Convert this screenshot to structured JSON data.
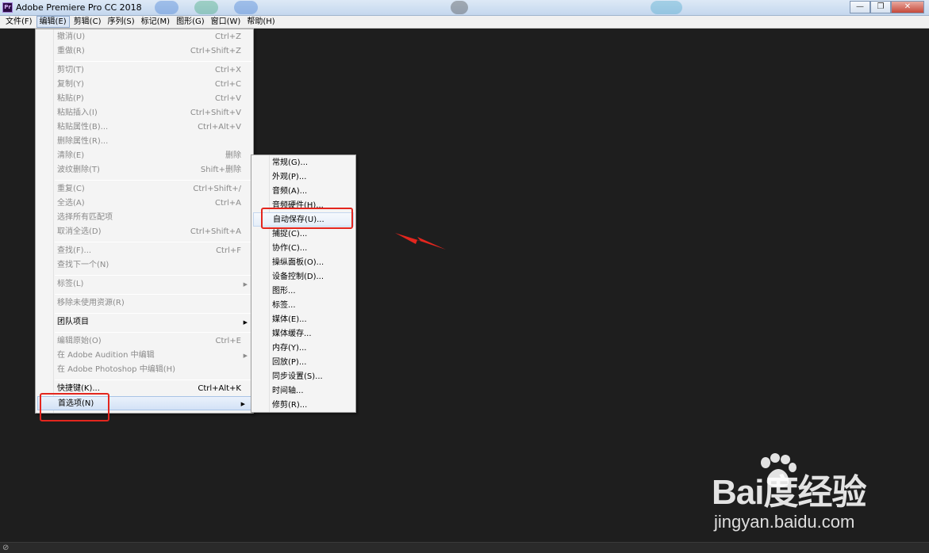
{
  "window": {
    "title": "Adobe Premiere Pro CC 2018",
    "app_icon_text": "Pr",
    "controls": {
      "minimize": "—",
      "restore": "❐",
      "close": "✕"
    }
  },
  "menubar": {
    "items": [
      "文件(F)",
      "编辑(E)",
      "剪辑(C)",
      "序列(S)",
      "标记(M)",
      "图形(G)",
      "窗口(W)",
      "帮助(H)"
    ],
    "active": "编辑(E)"
  },
  "edit_menu": {
    "items": [
      {
        "label": "撤消(U)",
        "shortcut": "Ctrl+Z"
      },
      {
        "label": "重做(R)",
        "shortcut": "Ctrl+Shift+Z"
      },
      {
        "label": "剪切(T)",
        "shortcut": "Ctrl+X"
      },
      {
        "label": "复制(Y)",
        "shortcut": "Ctrl+C"
      },
      {
        "label": "粘贴(P)",
        "shortcut": "Ctrl+V"
      },
      {
        "label": "粘贴插入(I)",
        "shortcut": "Ctrl+Shift+V"
      },
      {
        "label": "粘贴属性(B)...",
        "shortcut": "Ctrl+Alt+V"
      },
      {
        "label": "删除属性(R)...",
        "shortcut": ""
      },
      {
        "label": "清除(E)",
        "shortcut": "删除"
      },
      {
        "label": "波纹删除(T)",
        "shortcut": "Shift+删除"
      },
      {
        "label": "重复(C)",
        "shortcut": "Ctrl+Shift+/"
      },
      {
        "label": "全选(A)",
        "shortcut": "Ctrl+A"
      },
      {
        "label": "选择所有匹配项",
        "shortcut": ""
      },
      {
        "label": "取消全选(D)",
        "shortcut": "Ctrl+Shift+A"
      },
      {
        "label": "查找(F)...",
        "shortcut": "Ctrl+F"
      },
      {
        "label": "查找下一个(N)",
        "shortcut": ""
      },
      {
        "label": "标签(L)",
        "shortcut": ""
      },
      {
        "label": "移除未使用资源(R)",
        "shortcut": ""
      },
      {
        "label": "团队项目",
        "shortcut": ""
      },
      {
        "label": "编辑原始(O)",
        "shortcut": "Ctrl+E"
      },
      {
        "label": "在 Adobe Audition 中编辑",
        "shortcut": ""
      },
      {
        "label": "在 Adobe Photoshop 中编辑(H)",
        "shortcut": ""
      },
      {
        "label": "快捷键(K)...",
        "shortcut": "Ctrl+Alt+K"
      },
      {
        "label": "首选项(N)",
        "shortcut": ""
      }
    ]
  },
  "preferences_submenu": {
    "items": [
      "常规(G)...",
      "外观(P)...",
      "音频(A)...",
      "音频硬件(H)...",
      "自动保存(U)...",
      "捕捉(C)...",
      "协作(C)...",
      "操纵面板(O)...",
      "设备控制(D)...",
      "图形...",
      "标签...",
      "媒体(E)...",
      "媒体缓存...",
      "内存(Y)...",
      "回放(P)...",
      "同步设置(S)...",
      "时间轴...",
      "修剪(R)..."
    ]
  },
  "annotation_color": "#e3261e",
  "watermark": {
    "logo": "Bai度经验",
    "url": "jingyan.baidu.com"
  },
  "statusbar": {
    "icon": "link-icon"
  }
}
